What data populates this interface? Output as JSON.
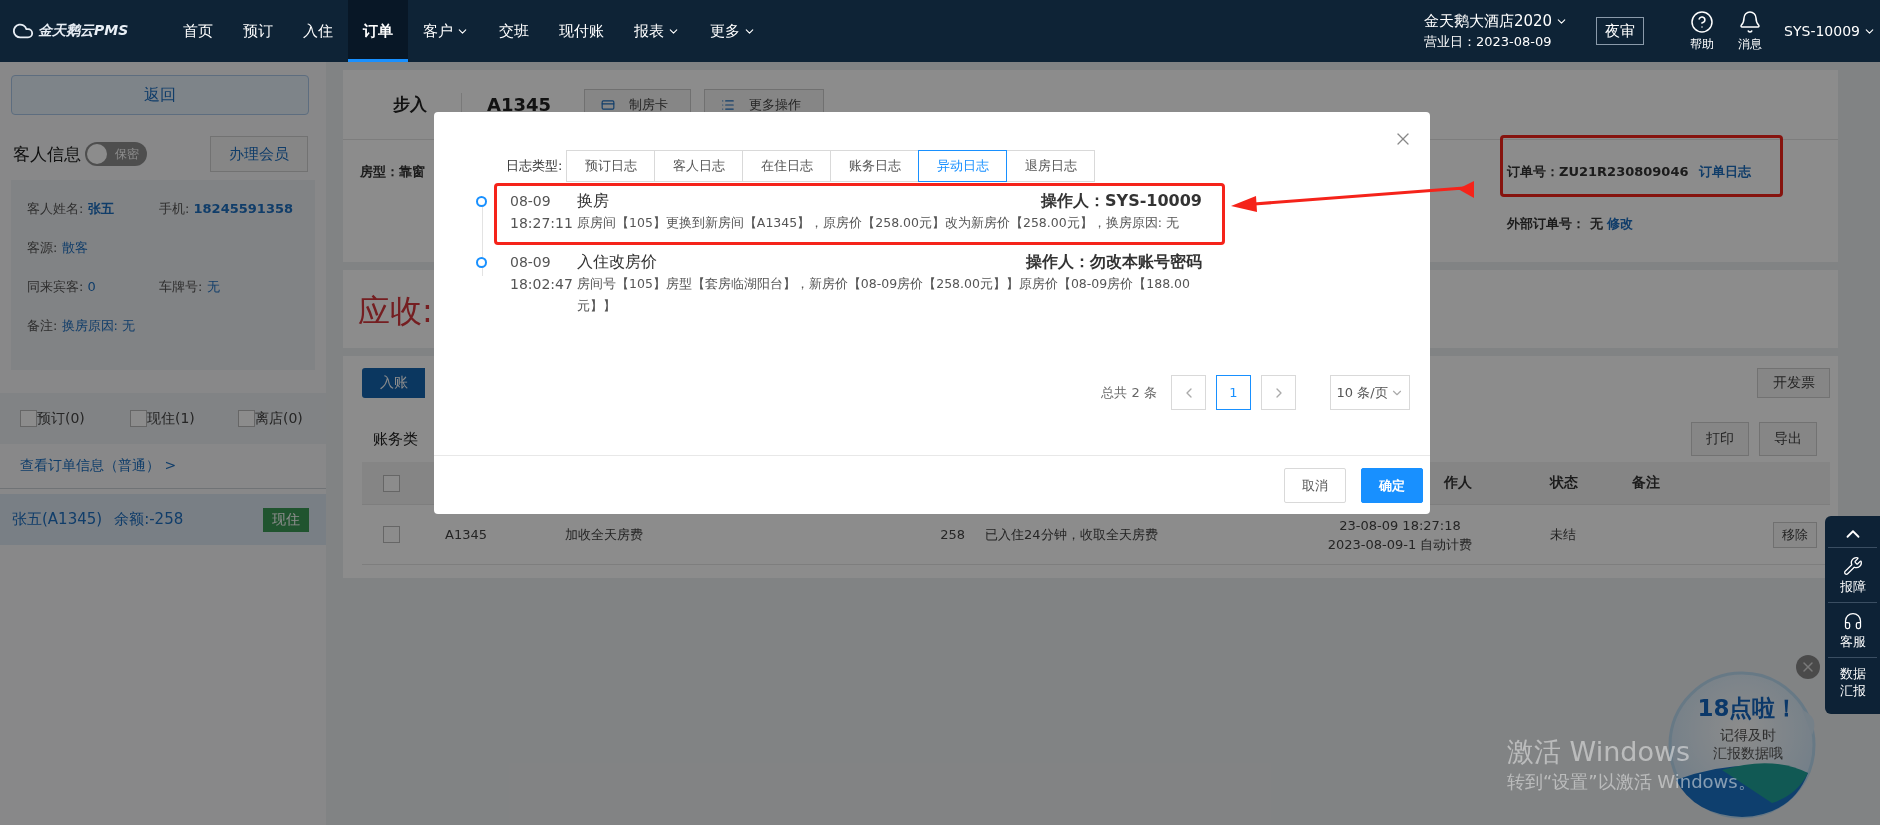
{
  "nav": {
    "logo": "金天鹅云PMS",
    "items": [
      {
        "label": "首页",
        "selected": false,
        "dropdown": false
      },
      {
        "label": "预订",
        "selected": false,
        "dropdown": false
      },
      {
        "label": "入住",
        "selected": false,
        "dropdown": false
      },
      {
        "label": "订单",
        "selected": true,
        "dropdown": false
      },
      {
        "label": "客户",
        "selected": false,
        "dropdown": true
      },
      {
        "label": "交班",
        "selected": false,
        "dropdown": false
      },
      {
        "label": "现付账",
        "selected": false,
        "dropdown": false
      },
      {
        "label": "报表",
        "selected": false,
        "dropdown": true
      },
      {
        "label": "更多",
        "selected": false,
        "dropdown": true
      }
    ],
    "hotel": "金天鹅大酒店2020",
    "business_date": "营业日：2023-08-09",
    "night_audit": "夜审",
    "help": "帮助",
    "messages": "消息",
    "user": "SYS-10009"
  },
  "sidebar": {
    "back": "返回",
    "guest_title": "客人信息",
    "privacy": {
      "label": "保密",
      "on": false
    },
    "member_button": "办理会员",
    "field_rows": [
      [
        {
          "label": "客人姓名:",
          "value": "张五"
        },
        {
          "label": "手机:",
          "value": "18245591358"
        }
      ],
      [
        {
          "label": "客源:",
          "value": "散客"
        }
      ],
      [
        {
          "label": "同来宾客:",
          "value": "0"
        },
        {
          "label": "车牌号:",
          "value": "无"
        }
      ],
      [
        {
          "label": "备注:",
          "value": "换房原因: 无"
        }
      ]
    ],
    "filters": [
      {
        "label": "预订(0)",
        "checked": false
      },
      {
        "label": "现住(1)",
        "checked": false
      },
      {
        "label": "离店(0)",
        "checked": false
      }
    ],
    "order_link": "查看订单信息（普通）",
    "order_link_arrow": ">",
    "guests": [
      {
        "name": "张五(A1345)",
        "balance": "余额:-258",
        "status": "现住",
        "selected": true
      }
    ]
  },
  "order": {
    "type": "步入",
    "room": "A1345",
    "actions": [
      "制房卡",
      "更多操作"
    ],
    "room_type": "房型：靠窗",
    "order_no": "订单号：ZU21R230809046",
    "order_log": "订单日志",
    "annotated": true,
    "external_label": "外部订单号：",
    "external_value": "无",
    "edit": "修改",
    "receivable": "应收:",
    "bill_tab": "入账",
    "invoice": "开发票",
    "category_label": "账务类",
    "print": "打印",
    "export": "导出",
    "header_checked": false,
    "header_operator": "作人",
    "header_status": "状态",
    "header_note": "备注",
    "rows": [
      {
        "checked": false,
        "room": "A1345",
        "item": "加收全天房费",
        "amount": "258",
        "description": "已入住24分钟，收取全天房费",
        "time": "23-08-09 18:27:18",
        "source": "2023-08-09-1 自动计费",
        "status": "未结",
        "action": "移除"
      }
    ]
  },
  "modal": {
    "type_label": "日志类型:",
    "tabs": [
      {
        "label": "预订日志",
        "selected": false
      },
      {
        "label": "客人日志",
        "selected": false
      },
      {
        "label": "在住日志",
        "selected": false
      },
      {
        "label": "账务日志",
        "selected": false
      },
      {
        "label": "异动日志",
        "selected": true
      },
      {
        "label": "退房日志",
        "selected": false
      }
    ],
    "entries": [
      {
        "date": "08-09",
        "time": "18:27:11",
        "title": "换房",
        "operator": "操作人：SYS-10009",
        "detail": "原房间【105】更换到新房间【A1345】，原房价【258.00元】改为新房价【258.00元】，换房原因: 无",
        "annotated": true
      },
      {
        "date": "08-09",
        "time": "18:02:47",
        "title": "入住改房价",
        "operator": "操作人：勿改本账号密码",
        "detail": "房间号【105】房型【套房临湖阳台】，新房价【08-09房价【258.00元】】原房价【08-09房价【188.00元】】",
        "annotated": false
      }
    ],
    "total": "总共 2 条",
    "pages": [
      {
        "label": "1",
        "selected": true
      }
    ],
    "page_size": "10 条/页",
    "cancel": "取消",
    "confirm": "确定"
  },
  "side_tools": [
    {
      "kind": "wrench",
      "label": "报障"
    },
    {
      "kind": "headset",
      "label": "客服"
    },
    {
      "kind": "text",
      "label": "数据汇报"
    }
  ],
  "bubble": {
    "title": "18点啦！",
    "lines": [
      "记得及时",
      "汇报数据哦"
    ]
  },
  "os_notice": {
    "title": "激活 Windows",
    "hint": "转到“设置”以激活 Windows。"
  }
}
